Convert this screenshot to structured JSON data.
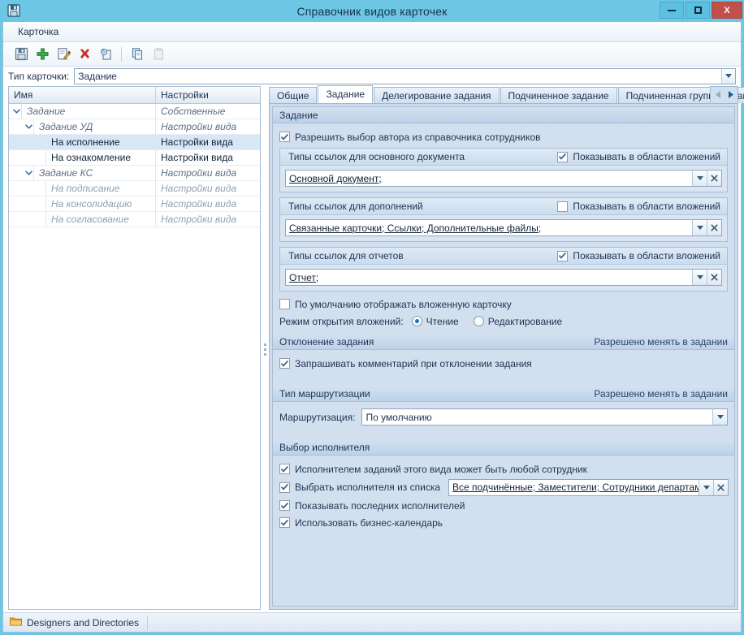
{
  "window": {
    "title": "Справочник видов карточек",
    "app_icon": "save-disk-icon",
    "minimize_label": "",
    "maximize_label": "",
    "close_label": "X"
  },
  "menubar": {
    "items": [
      {
        "label": "Карточка",
        "name": "menu-item-kartochka"
      }
    ]
  },
  "toolbar": {
    "buttons": [
      {
        "name": "save-icon",
        "title": "Сохранить",
        "enabled": true
      },
      {
        "name": "add-icon",
        "title": "Добавить",
        "enabled": true
      },
      {
        "name": "edit-icon",
        "title": "Изменить",
        "enabled": true
      },
      {
        "name": "delete-icon",
        "title": "Удалить",
        "enabled": true
      },
      {
        "name": "refresh-icon",
        "title": "Обновить",
        "enabled": true
      },
      {
        "name": "copy-icon",
        "title": "Копировать",
        "enabled": true
      },
      {
        "name": "paste-icon",
        "title": "Вставить",
        "enabled": false
      }
    ]
  },
  "cardtype": {
    "label": "Тип карточки:",
    "value": "Задание",
    "arrow_icon": "chevron-down-icon"
  },
  "tree": {
    "columns": [
      {
        "label": "Имя"
      },
      {
        "label": "Настройки"
      }
    ],
    "rows": [
      {
        "name": "Задание",
        "settings": "Собственные",
        "level": 0,
        "expander": "v",
        "style": "italic",
        "selected": false
      },
      {
        "name": "Задание УД",
        "settings": "Настройки вида",
        "level": 1,
        "expander": "v",
        "style": "italic",
        "selected": false
      },
      {
        "name": "На исполнение",
        "settings": "Настройки вида",
        "level": 2,
        "expander": "",
        "style": "normal",
        "selected": true
      },
      {
        "name": "На ознакомление",
        "settings": "Настройки вида",
        "level": 2,
        "expander": "",
        "style": "normal",
        "selected": false
      },
      {
        "name": "Задание КС",
        "settings": "Настройки вида",
        "level": 1,
        "expander": "v",
        "style": "italic",
        "selected": false
      },
      {
        "name": "На подписание",
        "settings": "Настройки вида",
        "level": 2,
        "expander": "",
        "style": "italic-faint",
        "selected": false
      },
      {
        "name": "На консолидацию",
        "settings": "Настройки вида",
        "level": 2,
        "expander": "",
        "style": "italic-faint",
        "selected": false
      },
      {
        "name": "На согласование",
        "settings": "Настройки вида",
        "level": 2,
        "expander": "",
        "style": "italic-faint",
        "selected": false
      }
    ]
  },
  "tabs": {
    "items": [
      {
        "label": "Общие",
        "active": false
      },
      {
        "label": "Задание",
        "active": true
      },
      {
        "label": "Делегирование задания",
        "active": false
      },
      {
        "label": "Подчиненное задание",
        "active": false
      },
      {
        "label": "Подчиненная группа заданий",
        "active": false
      }
    ],
    "scroll_left_icon": "chevron-left-icon",
    "scroll_right_icon": "chevron-right-icon"
  },
  "page": {
    "section_task": {
      "title": "Задание",
      "allow_author_checkbox": {
        "label": "Разрешить выбор автора из справочника сотрудников",
        "checked": true
      },
      "link_groups": [
        {
          "title": "Типы ссылок для основного документа",
          "show_in_attachments": {
            "label": "Показывать в области вложений",
            "checked": true
          },
          "value": "Основной документ;",
          "dropdown_icon": "chevron-down-icon",
          "clear_icon": "close-icon"
        },
        {
          "title": "Типы ссылок для дополнений",
          "show_in_attachments": {
            "label": "Показывать в области вложений",
            "checked": false
          },
          "value": "Связанные карточки; Ссылки; Дополнительные файлы;",
          "dropdown_icon": "chevron-down-icon",
          "clear_icon": "close-icon"
        },
        {
          "title": "Типы ссылок для отчетов",
          "show_in_attachments": {
            "label": "Показывать в области вложений",
            "checked": true
          },
          "value": "Отчет;",
          "dropdown_icon": "chevron-down-icon",
          "clear_icon": "close-icon"
        }
      ],
      "default_nested_card": {
        "label": "По умолчанию отображать вложенную карточку",
        "checked": false
      },
      "open_mode": {
        "label": "Режим открытия вложений:",
        "options": [
          {
            "label": "Чтение",
            "selected": true
          },
          {
            "label": "Редактирование",
            "selected": false
          }
        ]
      }
    },
    "section_reject": {
      "title": "Отклонение задания",
      "note": "Разрешено менять в задании",
      "ask_comment": {
        "label": "Запрашивать комментарий при отклонении задания",
        "checked": true
      }
    },
    "section_routing": {
      "title": "Тип маршрутизации",
      "note": "Разрешено менять в задании",
      "routing_label": "Маршрутизация:",
      "routing_value": "По умолчанию",
      "dropdown_icon": "chevron-down-icon"
    },
    "section_performer": {
      "title": "Выбор исполнителя",
      "any_employee": {
        "label": "Исполнителем заданий этого вида может быть любой сотрудник",
        "checked": true
      },
      "from_list": {
        "label": "Выбрать исполнителя из списка",
        "checked": true,
        "value": "Все подчинённые; Заместители; Сотрудники департамента авто",
        "dropdown_icon": "chevron-down-icon",
        "clear_icon": "close-icon"
      },
      "show_last": {
        "label": "Показывать последних исполнителей",
        "checked": true
      },
      "use_calendar": {
        "label": "Использовать бизнес-календарь",
        "checked": true
      }
    }
  },
  "statusbar": {
    "item_icon": "folder-icon",
    "item_label": "Designers and Directories"
  },
  "colors": {
    "window_frame": "#6dc6e4",
    "close_button": "#c1504a",
    "panel_bg": "#d2dfee",
    "selection": "#d8e7f5",
    "accent_text": "#1f3350"
  }
}
